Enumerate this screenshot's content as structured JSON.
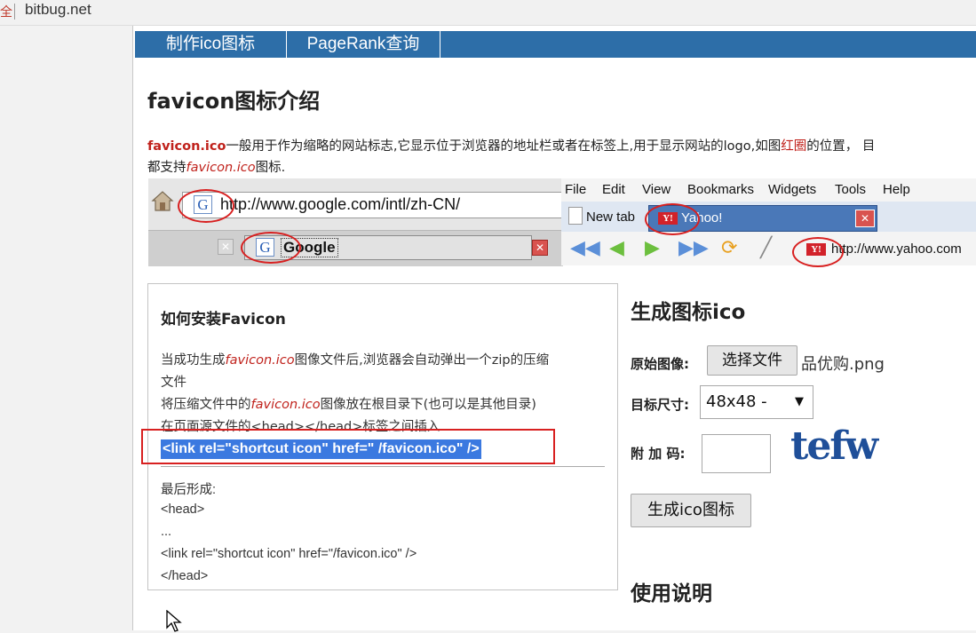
{
  "address_bar": {
    "security_glyph": "全",
    "url": "bitbug.net"
  },
  "nav": {
    "items": [
      "制作ico图标",
      "PageRank查询"
    ]
  },
  "main": {
    "title": "favicon图标介绍",
    "intro": {
      "term": "favicon.ico",
      "text1": "一般用于作为缩略的网站标志,它显示位于浏览器的地址栏或者在标签上,用于显示网站的logo,如图",
      "red_circle": "红圈",
      "text2": "的位置，  目",
      "line2_prefix": "都支持",
      "line2_term": "favicon.ico",
      "line2_suffix": "图标."
    }
  },
  "example": {
    "firefox": {
      "address": "http://www.google.com/intl/zh-CN/",
      "tab_label": "Google",
      "favicon": "G"
    },
    "opera": {
      "menu": [
        "File",
        "Edit",
        "View",
        "Bookmarks",
        "Widgets",
        "Tools",
        "Help"
      ],
      "new_tab": "New tab",
      "active_tab": "Yahoo!",
      "address": "http://www.yahoo.com",
      "favicon": "Y!"
    }
  },
  "install": {
    "title": "如何安装Favicon",
    "step1_prefix": "当成功生成",
    "step1_term": "favicon.ico",
    "step1_suffix": "图像文件后,浏览器会自动弹出一个zip的压缩",
    "step1_cont": "文件",
    "step2_prefix": "将压缩文件中的",
    "step2_term": "favicon.ico",
    "step2_suffix": "图像放在根目录下(也可以是其他目录)",
    "step3": "在页面源文件的<head></head>标签之间插入",
    "code_snippet": "<link rel=\"shortcut icon\" href=\" /favicon.ico\" />",
    "result_label": "最后形成:",
    "result_lines": [
      "<head>",
      "...",
      "<link rel=\"shortcut icon\" href=\"/favicon.ico\" />",
      "</head>"
    ]
  },
  "generate": {
    "title": "生成图标ico",
    "source_label": "原始图像:",
    "choose_file": "选择文件",
    "file_name": "品优购.png",
    "size_label": "目标尺寸:",
    "size_value": "48x48 -",
    "code_label": "附 加 码:",
    "captcha": "tefw",
    "submit": "生成ico图标"
  },
  "usage": {
    "title": "使用说明"
  }
}
